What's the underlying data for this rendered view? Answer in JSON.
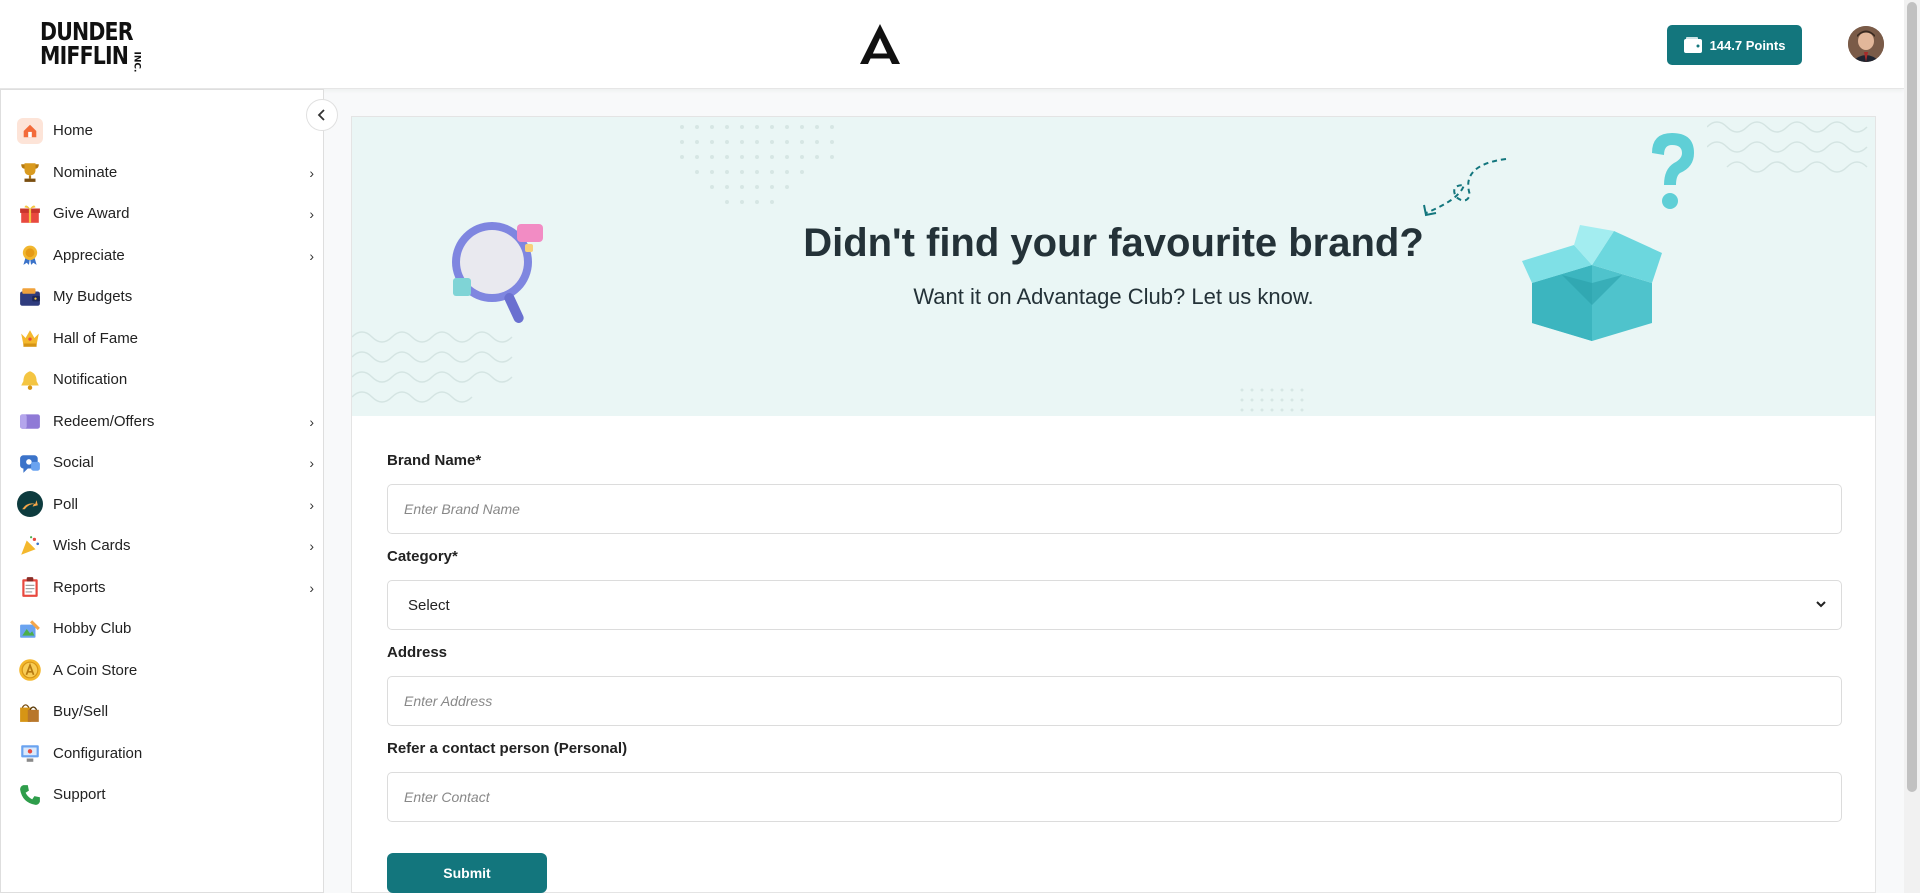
{
  "header": {
    "logo_line1": "DUNDER",
    "logo_line2": "MIFFLIN",
    "logo_suffix": "INC.",
    "points_label": "144.7  Points"
  },
  "sidebar": {
    "items": [
      {
        "label": "Home",
        "icon": "home-icon",
        "chevron": false
      },
      {
        "label": "Nominate",
        "icon": "trophy-icon",
        "chevron": true
      },
      {
        "label": "Give Award",
        "icon": "gift-icon",
        "chevron": true
      },
      {
        "label": "Appreciate",
        "icon": "medal-icon",
        "chevron": true
      },
      {
        "label": "My Budgets",
        "icon": "wallet-icon",
        "chevron": false
      },
      {
        "label": "Hall of Fame",
        "icon": "crown-icon",
        "chevron": false
      },
      {
        "label": "Notification",
        "icon": "bell-icon",
        "chevron": false
      },
      {
        "label": "Redeem/Offers",
        "icon": "voucher-icon",
        "chevron": true
      },
      {
        "label": "Social",
        "icon": "social-icon",
        "chevron": true
      },
      {
        "label": "Poll",
        "icon": "poll-icon",
        "chevron": true
      },
      {
        "label": "Wish Cards",
        "icon": "party-popper-icon",
        "chevron": true
      },
      {
        "label": "Reports",
        "icon": "clipboard-icon",
        "chevron": true
      },
      {
        "label": "Hobby Club",
        "icon": "hobby-icon",
        "chevron": false
      },
      {
        "label": "A Coin Store",
        "icon": "coin-icon",
        "chevron": false
      },
      {
        "label": "Buy/Sell",
        "icon": "shopping-bags-icon",
        "chevron": false
      },
      {
        "label": "Configuration",
        "icon": "computer-icon",
        "chevron": false
      },
      {
        "label": "Support",
        "icon": "phone-icon",
        "chevron": false
      }
    ]
  },
  "banner": {
    "title": "Didn't find your favourite brand?",
    "subtitle": "Want it on Advantage Club? Let us know."
  },
  "form": {
    "brand_label": "Brand Name*",
    "brand_placeholder": "Enter Brand Name",
    "category_label": "Category*",
    "category_value": "Select",
    "address_label": "Address",
    "address_placeholder": "Enter Address",
    "contact_label": "Refer a contact person (Personal)",
    "contact_placeholder": "Enter Contact",
    "submit_label": "Submit"
  },
  "colors": {
    "accent": "#13767d",
    "banner_bg": "#eaf6f5",
    "title_text": "#243238"
  }
}
